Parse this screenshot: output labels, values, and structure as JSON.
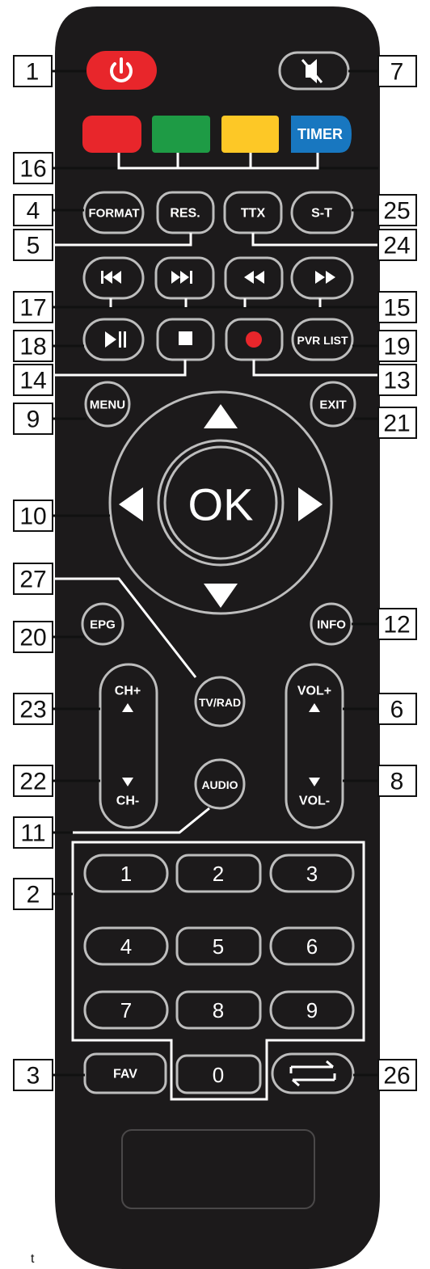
{
  "buttons": {
    "format": "FORMAT",
    "res": "RES.",
    "ttx": "TTX",
    "st": "S-T",
    "pvr_list": "PVR LIST",
    "timer": "TIMER",
    "menu": "MENU",
    "exit": "EXIT",
    "ok": "OK",
    "epg": "EPG",
    "info": "INFO",
    "tv_rad": "TV/RAD",
    "audio": "AUDIO",
    "ch_plus": "CH+",
    "ch_minus": "CH-",
    "vol_plus": "VOL+",
    "vol_minus": "VOL-",
    "fav": "FAV",
    "digits": [
      "1",
      "2",
      "3",
      "4",
      "5",
      "6",
      "7",
      "8",
      "9",
      "0"
    ]
  },
  "labels": {
    "l1": "1",
    "l2": "2",
    "l3": "3",
    "l4": "4",
    "l5": "5",
    "l6": "6",
    "l7": "7",
    "l8": "8",
    "l9": "9",
    "l10": "10",
    "l11": "11",
    "l12": "12",
    "l13": "13",
    "l14": "14",
    "l15": "15",
    "l16": "16",
    "l17": "17",
    "l18": "18",
    "l19": "19",
    "l20": "20",
    "l21": "21",
    "l22": "22",
    "l23": "23",
    "l24": "24",
    "l25": "25",
    "l26": "26",
    "l27": "27"
  },
  "footer_fragment": "t",
  "colors": {
    "body": "#1c1a1b",
    "power": "#e8262b",
    "red": "#e8262b",
    "green": "#1e9b45",
    "yellow": "#fdc826",
    "timer": "#1877c0",
    "button_outline": "#bdbdbd"
  }
}
